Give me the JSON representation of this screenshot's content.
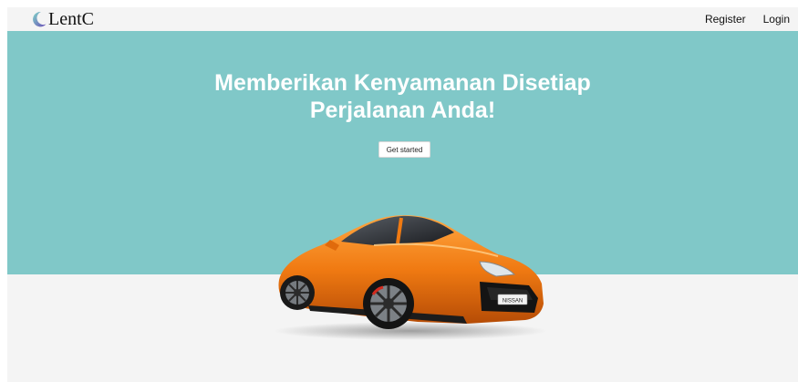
{
  "navbar": {
    "brand": "LentC",
    "brand_icon": "crescent-moon-icon",
    "links": {
      "register": "Register",
      "login": "Login"
    }
  },
  "hero": {
    "title_line1": "Memberikan Kenyamanan Disetiap",
    "title_line2": "Perjalanan Anda!",
    "cta_label": "Get started",
    "image": {
      "plate": "NISSAN",
      "icon": "orange-sports-car-image"
    }
  },
  "colors": {
    "hero_bg": "#80c8c8",
    "page_bg": "#f4f4f4",
    "car_body": "#f07a12"
  }
}
